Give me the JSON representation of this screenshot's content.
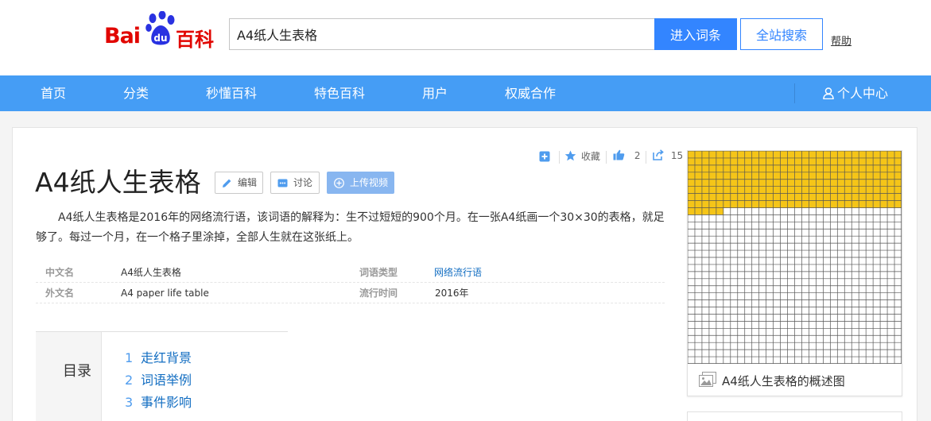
{
  "header": {
    "logo_left": "Bai",
    "logo_paw_text": "du",
    "logo_right": "百科",
    "search_value": "A4纸人生表格",
    "enter_button": "进入词条",
    "site_search_button": "全站搜索",
    "help_link": "帮助"
  },
  "nav": {
    "items": [
      "首页",
      "分类",
      "秒懂百科",
      "特色百科",
      "用户",
      "权威合作"
    ],
    "user_center": "个人中心",
    "user_icon": "user-icon"
  },
  "entry": {
    "title": "A4纸人生表格",
    "edit_button": "编辑",
    "discuss_button": "讨论",
    "upload_video_button": "上传视频",
    "actions": {
      "collect": "收藏",
      "like_count": "2",
      "share_count": "15"
    },
    "summary": "A4纸人生表格是2016年的网络流行语，该词语的解释为：生不过短短的900个月。在一张A4纸画一个30×30的表格，就足够了。每过一个月，在一个格子里涂掉，全部人生就在这张纸上。",
    "basic_info": [
      {
        "label": "中文名",
        "value": "A4纸人生表格",
        "label2": "词语类型",
        "value2": "网络流行语"
      },
      {
        "label": "外文名",
        "value": "A4 paper life table",
        "label2": "流行时间",
        "value2": "2016年"
      }
    ],
    "catalog": {
      "title": "目录",
      "items": [
        {
          "num": "1",
          "label": "走红背景"
        },
        {
          "num": "2",
          "label": "词语举例"
        },
        {
          "num": "3",
          "label": "事件影响"
        }
      ]
    },
    "picture": {
      "caption": "A4纸人生表格的概述图",
      "grid_rows": 30,
      "grid_cols": 30,
      "filled_cells": 245,
      "fill_color": "#f5c518",
      "line_color": "#555555"
    }
  },
  "colors": {
    "brand_red": "#e10601",
    "accent_blue": "#3385ff",
    "nav_blue": "#459df5",
    "link_blue": "#136ec2"
  }
}
